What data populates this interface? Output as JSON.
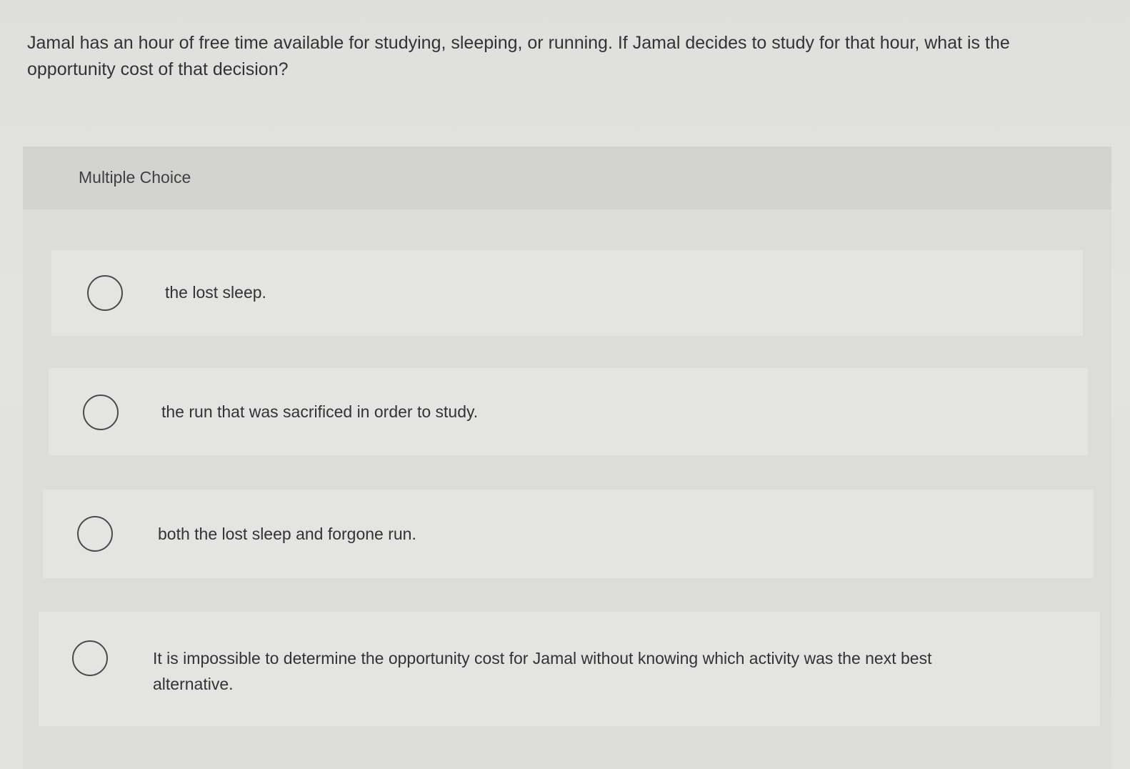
{
  "question": {
    "text": "Jamal has an hour of free time available for studying, sleeping, or running. If Jamal decides to study for that hour, what is the opportunity cost of that decision?"
  },
  "multiple_choice": {
    "header": "Multiple Choice",
    "options": [
      {
        "label": "the lost sleep."
      },
      {
        "label": "the run that was sacrificed in order to study."
      },
      {
        "label": "both the lost sleep and forgone run."
      },
      {
        "label": "It is impossible to determine the opportunity cost for Jamal without knowing which activity was the next best alternative."
      }
    ]
  }
}
